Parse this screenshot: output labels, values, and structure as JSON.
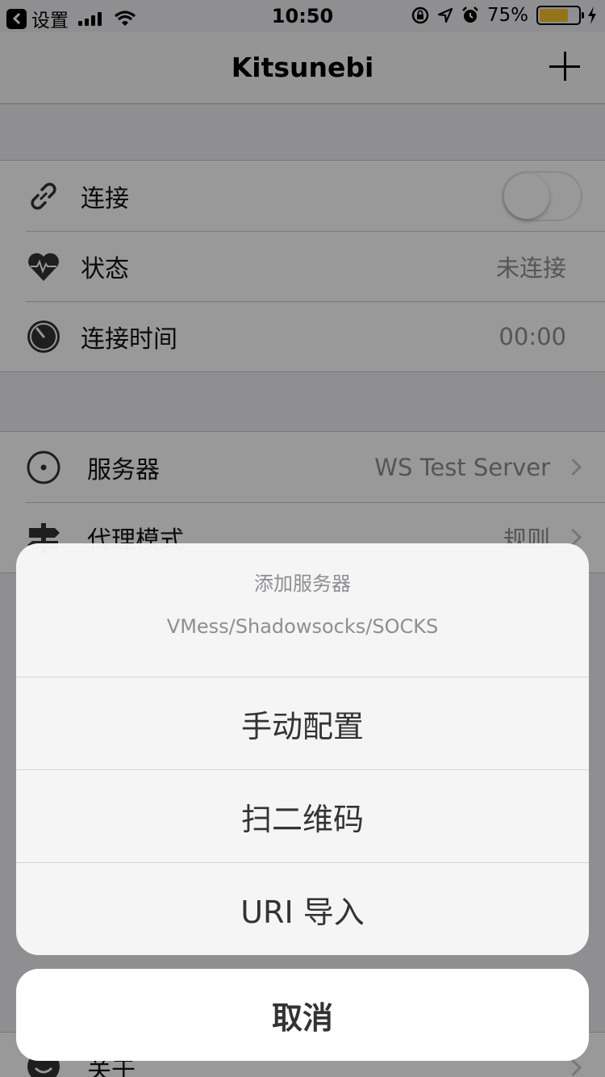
{
  "statusbar": {
    "back_app": "设置",
    "time": "10:50",
    "battery_percent": "75%",
    "battery_level": 0.75,
    "battery_color": "#f5c12e"
  },
  "nav": {
    "title": "Kitsunebi"
  },
  "connection_group": {
    "connect_label": "连接",
    "connect_on": false,
    "status_label": "状态",
    "status_value": "未连接",
    "time_label": "连接时间",
    "time_value": "00:00"
  },
  "server_group": {
    "server_label": "服务器",
    "server_value": "WS Test Server",
    "proxy_label": "代理模式",
    "proxy_value": "规则"
  },
  "bottom_group": {
    "about_label": "关于"
  },
  "sheet": {
    "title": "添加服务器",
    "message": "VMess/Shadowsocks/SOCKS",
    "actions": [
      {
        "label": "手动配置"
      },
      {
        "label": "扫二维码"
      },
      {
        "label": "URI 导入"
      }
    ],
    "cancel_label": "取消"
  }
}
